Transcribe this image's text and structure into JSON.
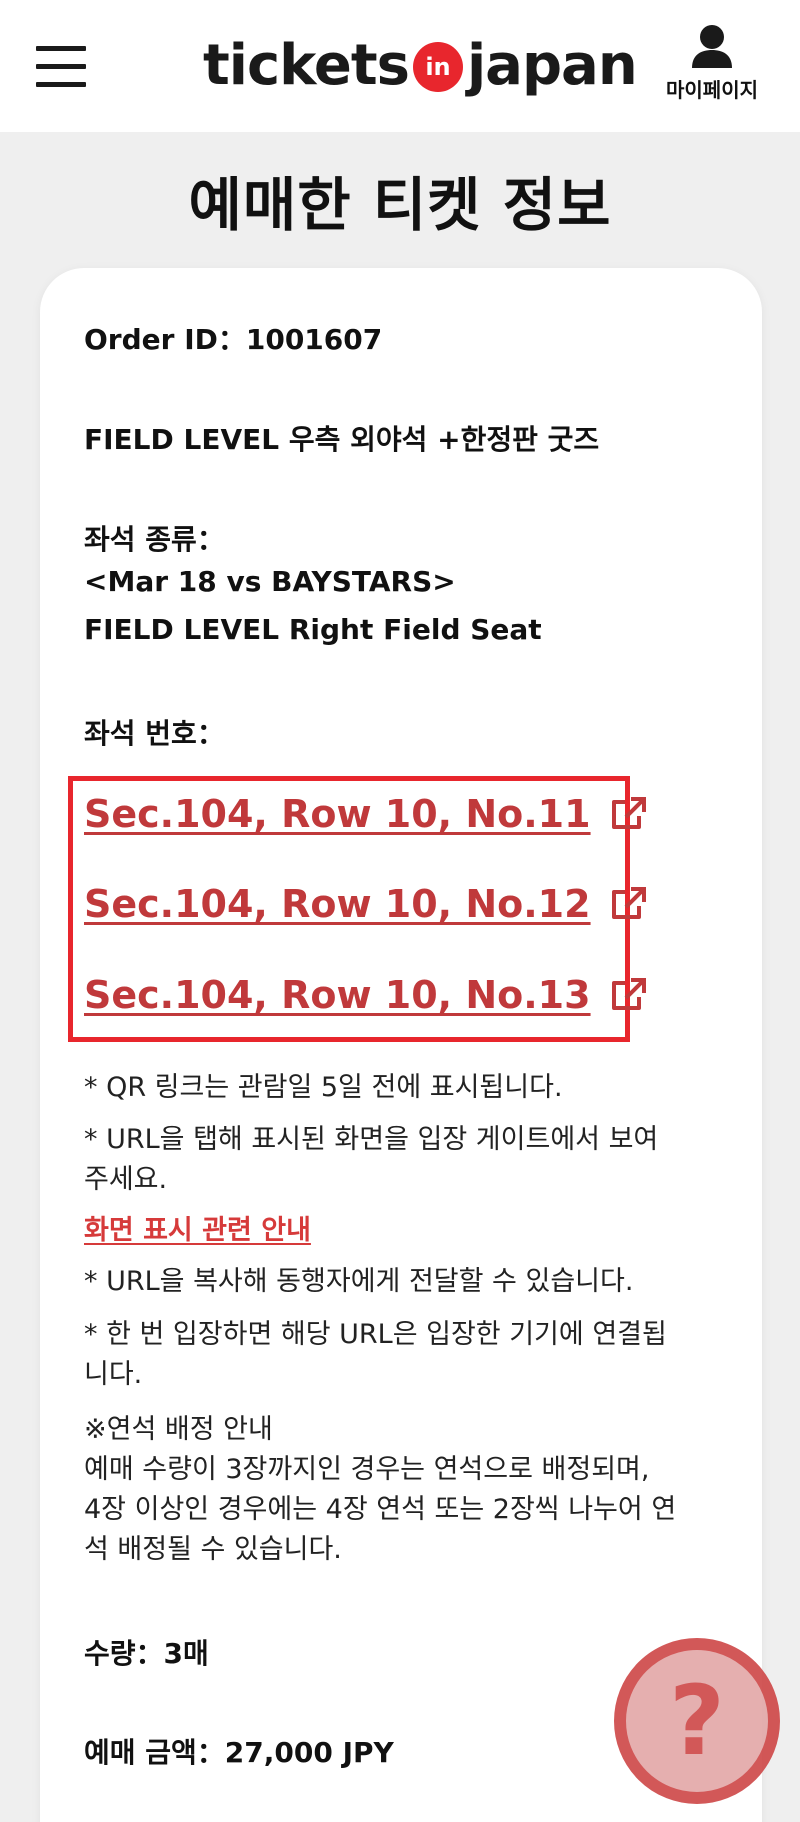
{
  "header": {
    "logo_left": "tickets",
    "logo_badge": "in",
    "logo_right": "japan",
    "mypage_label": "마이페이지"
  },
  "page_title": "예매한 티켓 정보",
  "order": {
    "order_id_line": "Order ID：1001607",
    "product_name": "FIELD LEVEL 우측 외야석 +한정판 굿즈",
    "seat_type_label": "좌석 종류：",
    "seat_type_line1": "<Mar 18 vs BAYSTARS>",
    "seat_type_line2": "FIELD LEVEL Right Field Seat",
    "seat_number_label": "좌석 번호：",
    "seats": [
      "Sec.104, Row 10, No.11",
      "Sec.104, Row 10, No.12",
      "Sec.104, Row 10, No.13"
    ]
  },
  "notes": {
    "n1": "* QR 링크는 관람일 5일 전에 표시됩니다.",
    "n2a": "* URL을 탭해 표시된 화면을 입장 게이트에서 보여",
    "n2b": "주세요.",
    "guide_link": "화면 표시 관련 안내",
    "n3": "* URL을 복사해 동행자에게 전달할 수 있습니다.",
    "n4a": "* 한 번 입장하면 해당 URL은 입장한 기기에 연결됩",
    "n4b": "니다.",
    "n5_title": "※연석 배정 안내",
    "n5a": "예매 수량이 3장까지인 경우는 연석으로 배정되며,",
    "n5b": "4장 이상인 경우에는 4장 연석 또는 2장씩 나누어 연",
    "n5c": "석 배정될 수 있습니다."
  },
  "summary": {
    "quantity_line": "수량：3매",
    "amount_line": "예매 금액：27,000 JPY"
  },
  "help_button_label": "?",
  "colors": {
    "brand_red": "#e8262d",
    "link_red": "#c0393b",
    "background": "#efefef"
  }
}
